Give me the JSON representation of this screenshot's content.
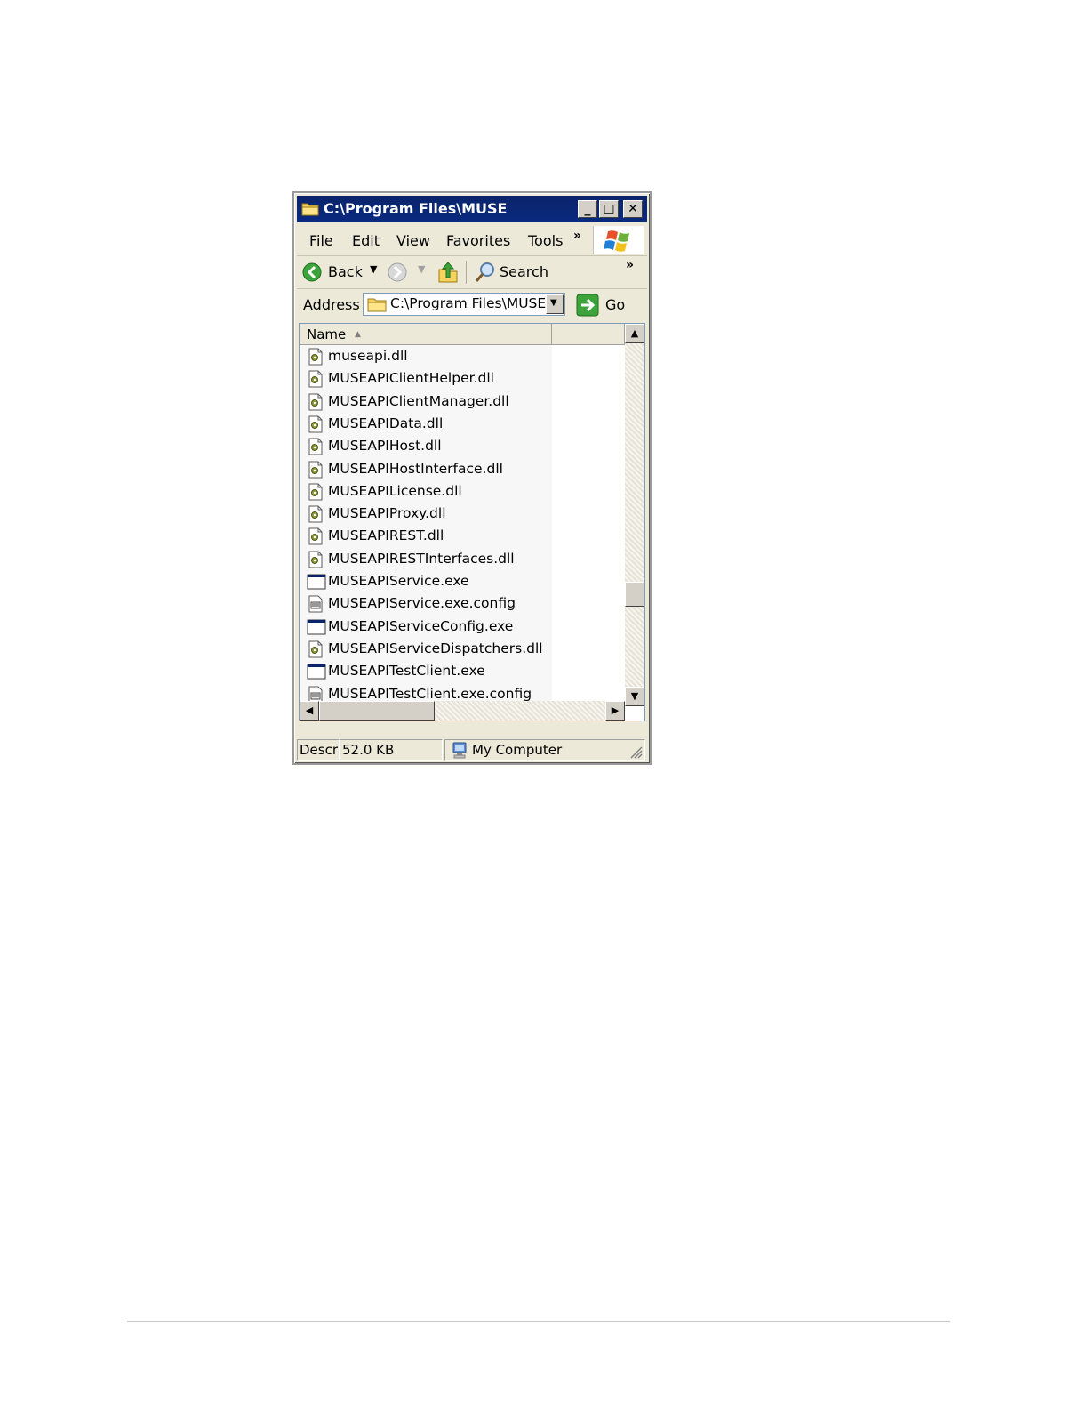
{
  "window": {
    "title": "C:\\Program Files\\MUSE",
    "controls": {
      "minimize": "_",
      "maximize": "□",
      "close": "✕"
    }
  },
  "menubar": {
    "items": [
      "File",
      "Edit",
      "View",
      "Favorites",
      "Tools"
    ],
    "overflow": "»"
  },
  "toolbar": {
    "back_label": "Back",
    "search_label": "Search",
    "overflow": "»"
  },
  "address": {
    "label": "Address",
    "value": "C:\\Program Files\\MUSE",
    "go_label": "Go"
  },
  "listview": {
    "columns": [
      "Name"
    ],
    "sort_indicator": "▲",
    "files": [
      {
        "name": "museapi.dll",
        "icon": "dll-icon"
      },
      {
        "name": "MUSEAPIClientHelper.dll",
        "icon": "dll-icon"
      },
      {
        "name": "MUSEAPIClientManager.dll",
        "icon": "dll-icon"
      },
      {
        "name": "MUSEAPIData.dll",
        "icon": "dll-icon"
      },
      {
        "name": "MUSEAPIHost.dll",
        "icon": "dll-icon"
      },
      {
        "name": "MUSEAPIHostInterface.dll",
        "icon": "dll-icon"
      },
      {
        "name": "MUSEAPILicense.dll",
        "icon": "dll-icon"
      },
      {
        "name": "MUSEAPIProxy.dll",
        "icon": "dll-icon"
      },
      {
        "name": "MUSEAPIREST.dll",
        "icon": "dll-icon"
      },
      {
        "name": "MUSEAPIRESTInterfaces.dll",
        "icon": "dll-icon"
      },
      {
        "name": "MUSEAPIService.exe",
        "icon": "exe-icon"
      },
      {
        "name": "MUSEAPIService.exe.config",
        "icon": "config-icon"
      },
      {
        "name": "MUSEAPIServiceConfig.exe",
        "icon": "exe-icon"
      },
      {
        "name": "MUSEAPIServiceDispatchers.dll",
        "icon": "dll-icon"
      },
      {
        "name": "MUSEAPITestClient.exe",
        "icon": "exe-icon"
      },
      {
        "name": "MUSEAPITestClient.exe.config",
        "icon": "config-icon"
      }
    ]
  },
  "statusbar": {
    "description": "Descri",
    "size": "52.0 KB",
    "zone": "My Computer"
  }
}
